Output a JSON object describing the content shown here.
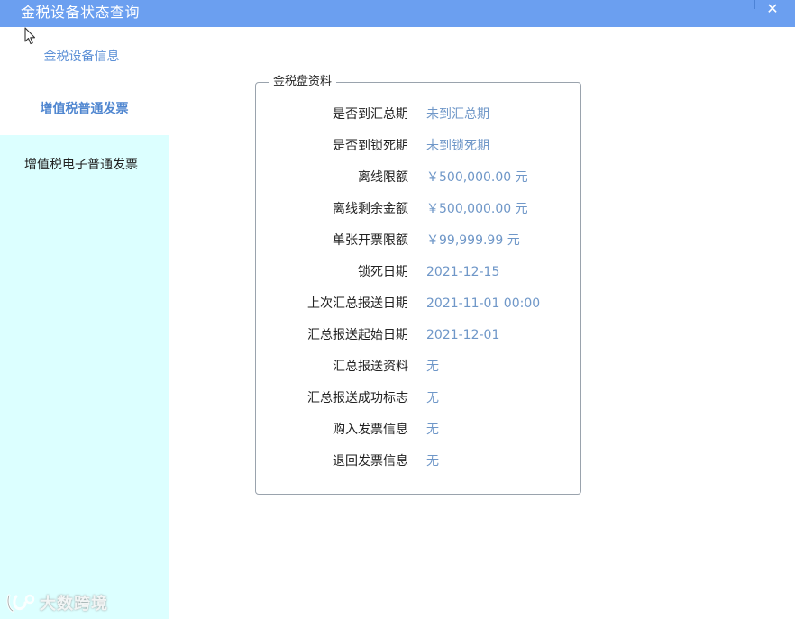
{
  "window": {
    "title": "金税设备状态查询",
    "close_glyph": "✕"
  },
  "sidebar": {
    "items": [
      {
        "label": "金税设备信息"
      },
      {
        "label": "增值税普通发票"
      },
      {
        "label": "增值税电子普通发票"
      }
    ]
  },
  "panel": {
    "legend": "金税盘资料",
    "rows": [
      {
        "label": "是否到汇总期",
        "value": "未到汇总期"
      },
      {
        "label": "是否到锁死期",
        "value": "未到锁死期"
      },
      {
        "label": "离线限额",
        "value": "￥500,000.00 元"
      },
      {
        "label": "离线剩余金额",
        "value": "￥500,000.00 元"
      },
      {
        "label": "单张开票限额",
        "value": "￥99,999.99 元"
      },
      {
        "label": "锁死日期",
        "value": "2021-12-15"
      },
      {
        "label": "上次汇总报送日期",
        "value": "2021-11-01 00:00"
      },
      {
        "label": "汇总报送起始日期",
        "value": "2021-12-01"
      },
      {
        "label": "汇总报送资料",
        "value": "无"
      },
      {
        "label": "汇总报送成功标志",
        "value": "无"
      },
      {
        "label": "购入发票信息",
        "value": "无"
      },
      {
        "label": "退回发票信息",
        "value": "无"
      }
    ]
  },
  "watermark": {
    "text": "大数跨境"
  },
  "colors": {
    "titlebar": "#6b9ff0",
    "sidebar_active_bg": "#dcffff",
    "value_text": "#6f97c8",
    "nav_accent": "#4f86d0"
  }
}
